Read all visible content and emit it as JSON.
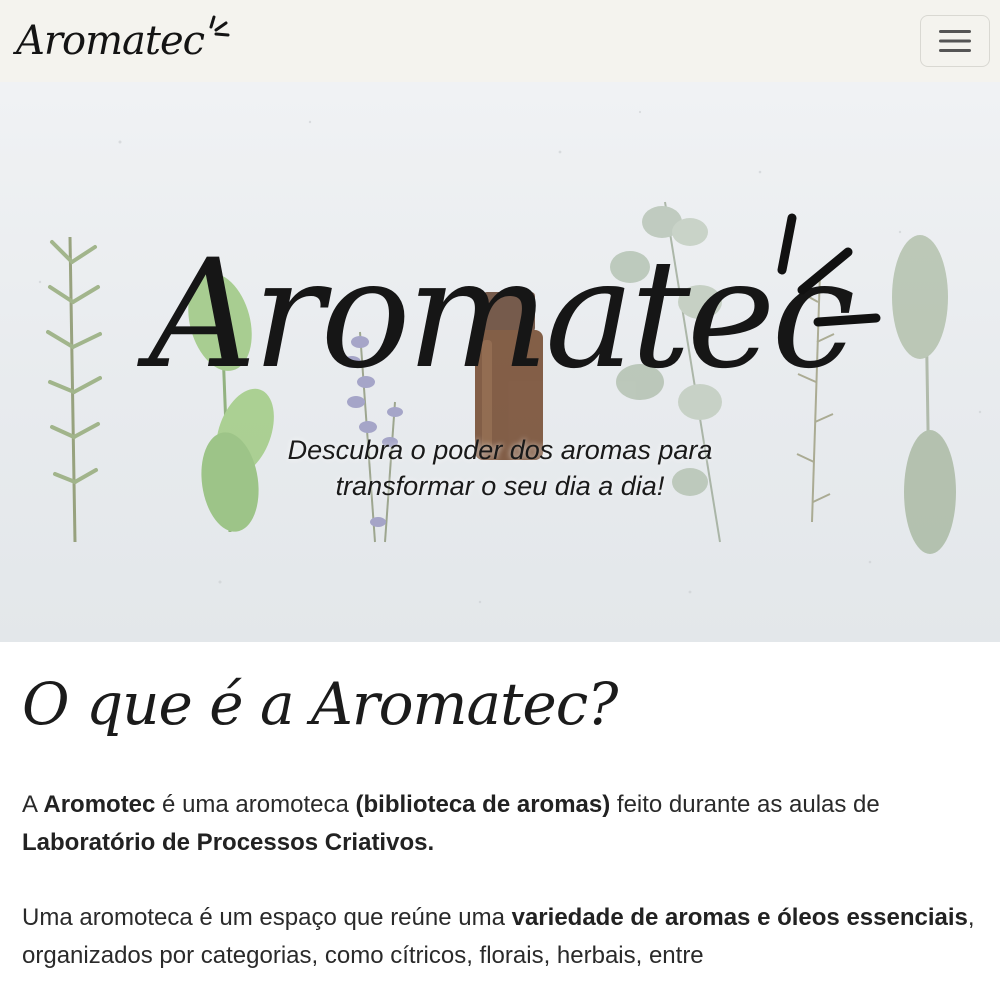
{
  "navbar": {
    "brand": "Aromatec",
    "menu_icon": "hamburger-menu-icon"
  },
  "hero": {
    "title": "Aromatec",
    "subtitle_line1": "Descubra o poder dos aromas para",
    "subtitle_line2": "transformar o seu dia a dia!",
    "background": "herbs-and-essential-oil-bottle"
  },
  "about": {
    "title": "O que é a Aromatec?",
    "p1": {
      "t1": "A ",
      "b1": "Aromotec",
      "t2": " é uma aromoteca ",
      "b2": "(biblioteca de aromas)",
      "t3": " feito durante as aulas de ",
      "b3": "Laboratório de Processos Criativos."
    },
    "p2": {
      "t1": "Uma aromoteca é um espaço que reúne uma ",
      "b1": "variedade de aromas e óleos essenciais",
      "t2": ", organizados por categorias, como cítricos, florais, herbais, entre"
    }
  },
  "colors": {
    "navbar_bg": "#f4f3ee",
    "text": "#222222",
    "hero_bg": "#eceff1"
  }
}
